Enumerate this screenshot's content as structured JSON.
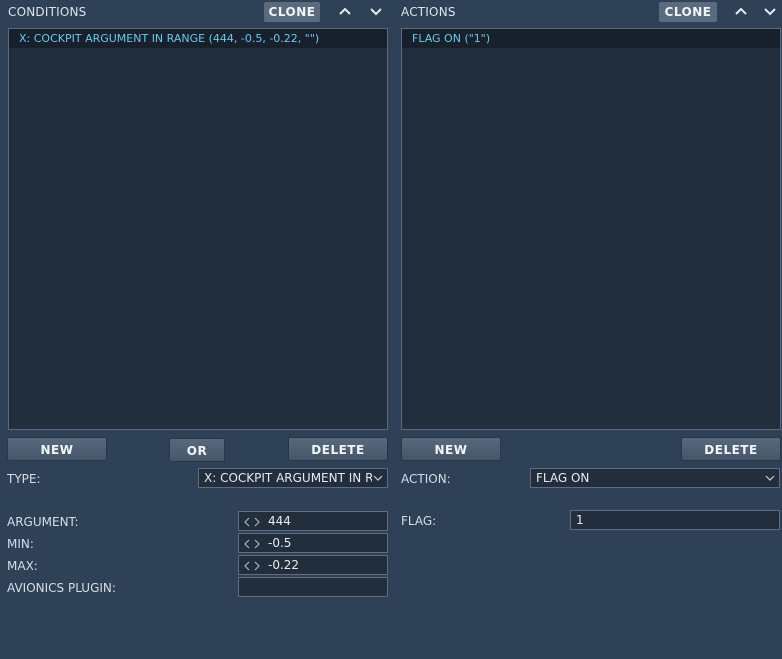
{
  "conditions": {
    "title": "CONDITIONS",
    "clone_label": "CLONE",
    "items": [
      "X: COCKPIT ARGUMENT IN RANGE (444, -0.5, -0.22, \"\")"
    ],
    "new_label": "NEW",
    "or_label": "OR",
    "delete_label": "DELETE",
    "type_label": "TYPE:",
    "type_value": "X: COCKPIT ARGUMENT IN RA",
    "params": [
      {
        "label": "ARGUMENT:",
        "value": "444"
      },
      {
        "label": "MIN:",
        "value": "-0.5"
      },
      {
        "label": "MAX:",
        "value": "-0.22"
      },
      {
        "label": "AVIONICS PLUGIN:",
        "value": ""
      }
    ]
  },
  "actions": {
    "title": "ACTIONS",
    "clone_label": "CLONE",
    "items": [
      "FLAG ON (\"1\")"
    ],
    "new_label": "NEW",
    "delete_label": "DELETE",
    "action_label": "ACTION:",
    "action_value": "FLAG ON",
    "params": [
      {
        "label": "FLAG:",
        "value": "1"
      }
    ]
  },
  "icons": {
    "move_up": "chevron-up-icon",
    "move_down": "chevron-down-icon",
    "dropdown": "chevron-down-icon",
    "spin_left": "chevron-left-icon",
    "spin_right": "chevron-right-icon"
  },
  "colors": {
    "background": "#2f4156",
    "list_background": "#222e3b",
    "selected_row": "#18212b",
    "selected_text": "#66c9ee",
    "button": "#52637a"
  }
}
